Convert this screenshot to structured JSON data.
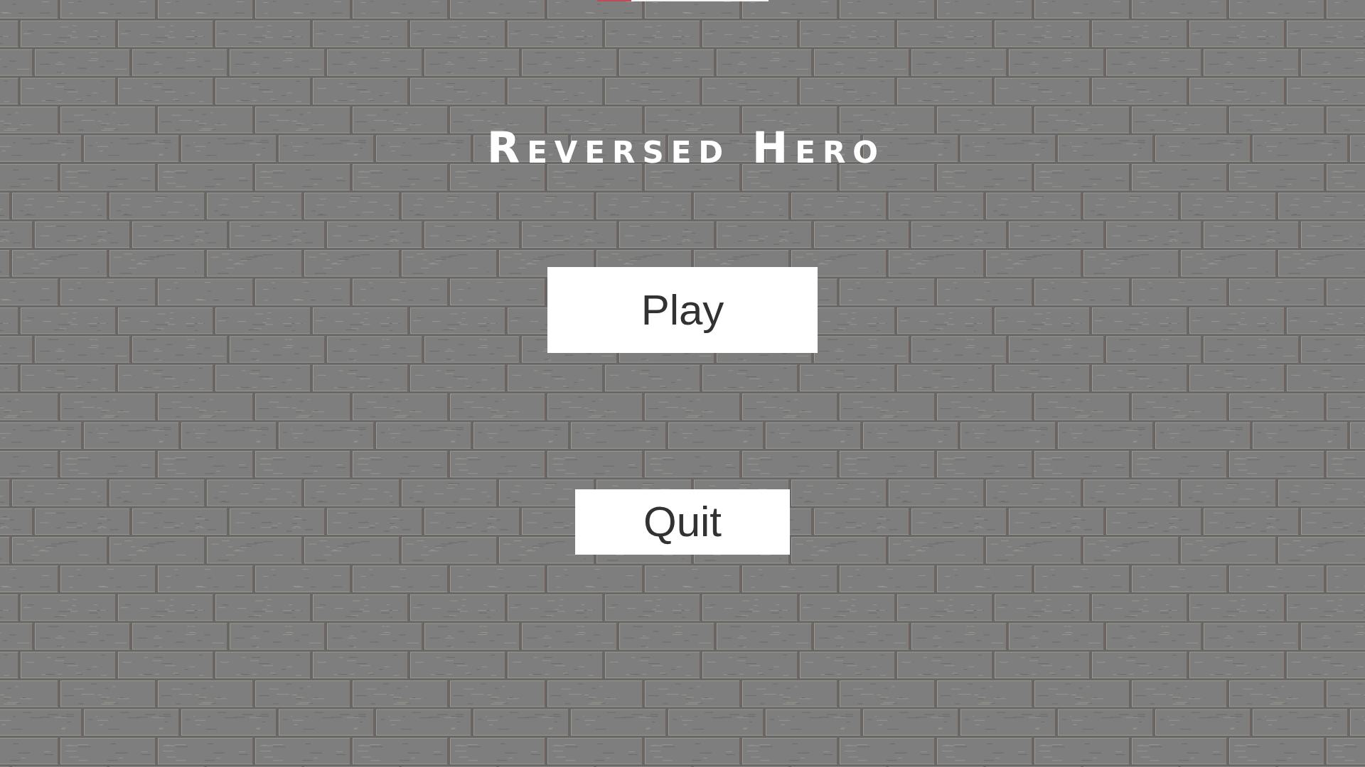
{
  "top_bar": {
    "level": 0.2
  },
  "title": "Reversed Hero",
  "buttons": [
    {
      "label": "Play"
    },
    {
      "label": "Quit"
    }
  ]
}
